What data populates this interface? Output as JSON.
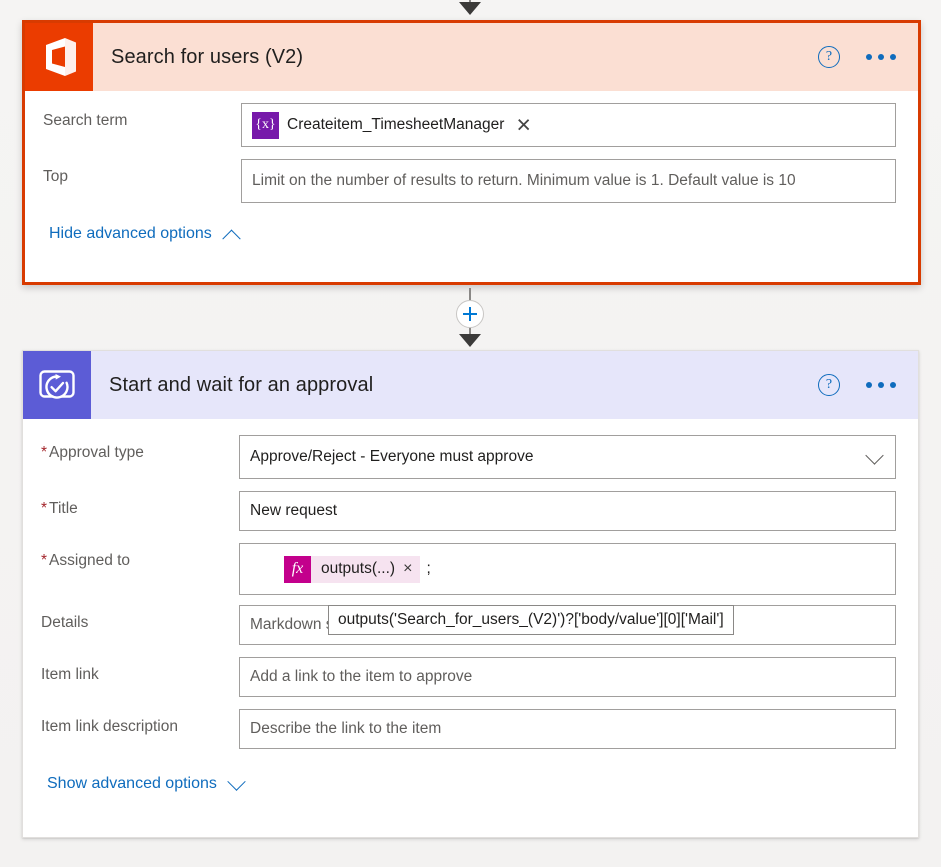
{
  "connector": {
    "plus_label": "+",
    "plus_name": "insert-new-step-button"
  },
  "cards": [
    {
      "id": "search-for-users",
      "title": "Search for users (V2)",
      "icon": "office365-users-icon",
      "accent": "#d83b01",
      "header_bg": "#fbdfd3",
      "selected": true,
      "help_label": "?",
      "rows": [
        {
          "label": "Search term",
          "required": false,
          "type": "token",
          "token": {
            "badge": "{x}",
            "badge_kind": "dynamic",
            "text": "Createitem_TimesheetManager",
            "remove_label": "×"
          }
        },
        {
          "label": "Top",
          "required": false,
          "type": "placeholder",
          "placeholder": "Limit on the number of results to return. Minimum value is 1. Default value is 10"
        }
      ],
      "advanced": {
        "label": "Hide advanced options",
        "caret": "up"
      }
    },
    {
      "id": "start-and-wait-for-an-approval",
      "title": "Start and wait for an approval",
      "icon": "approvals-icon",
      "accent": "#5c5cd6",
      "header_bg": "#e6e6fa",
      "selected": false,
      "help_label": "?",
      "rows": [
        {
          "label": "Approval type",
          "required": true,
          "type": "select",
          "value": "Approve/Reject - Everyone must approve"
        },
        {
          "label": "Title",
          "required": true,
          "type": "value",
          "value": "New request"
        },
        {
          "label": "Assigned to",
          "required": true,
          "type": "expression",
          "token": {
            "badge": "fx",
            "badge_kind": "expression",
            "text": "outputs(...)",
            "remove_label": "×"
          },
          "trailing": ";"
        },
        {
          "label": "Details",
          "required": false,
          "type": "placeholder",
          "placeholder": "Markdown supported (see https://aka.ms/approvaldetails)"
        },
        {
          "label": "Item link",
          "required": false,
          "type": "placeholder",
          "placeholder": "Add a link to the item to approve"
        },
        {
          "label": "Item link description",
          "required": false,
          "type": "placeholder",
          "placeholder": "Describe the link to the item"
        }
      ],
      "advanced": {
        "label": "Show advanced options",
        "caret": "down"
      }
    }
  ],
  "tooltip": {
    "text": "outputs('Search_for_users_(V2)')?['body/value'][0]['Mail']"
  }
}
